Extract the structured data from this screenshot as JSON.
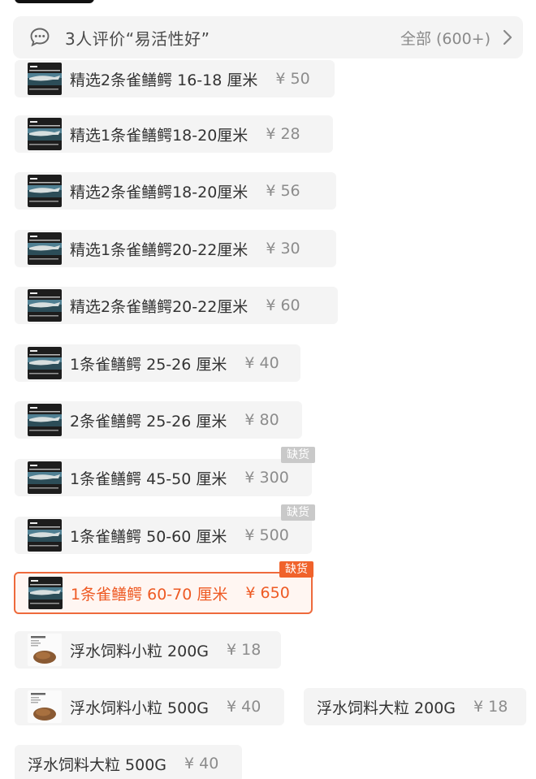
{
  "reviews": {
    "summary": "3人评价“易活性好”",
    "all_label": "全部 (600+)"
  },
  "options": [
    {
      "name": "精选2条雀鳝鳄 16-18 厘米",
      "price": "¥ 50",
      "thumb": "fish"
    },
    {
      "name": "精选1条雀鳝鳄18-20厘米",
      "price": "¥ 28",
      "thumb": "fish"
    },
    {
      "name": "精选2条雀鳝鳄18-20厘米",
      "price": "¥ 56",
      "thumb": "fish"
    },
    {
      "name": "精选1条雀鳝鳄20-22厘米",
      "price": "¥ 30",
      "thumb": "fish"
    },
    {
      "name": "精选2条雀鳝鳄20-22厘米",
      "price": "¥ 60",
      "thumb": "fish"
    },
    {
      "name": "1条雀鳝鳄 25-26 厘米",
      "price": "¥ 40",
      "thumb": "fish"
    },
    {
      "name": "2条雀鳝鳄 25-26 厘米",
      "price": "¥ 80",
      "thumb": "fish"
    },
    {
      "name": "1条雀鳝鳄 45-50 厘米",
      "price": "¥ 300",
      "thumb": "fish",
      "tag": "缺货"
    },
    {
      "name": "1条雀鳝鳄 50-60 厘米",
      "price": "¥ 500",
      "thumb": "fish",
      "tag": "缺货"
    },
    {
      "name": "1条雀鳝鳄 60-70 厘米",
      "price": "¥ 650",
      "thumb": "fish",
      "tag": "缺货",
      "selected": true
    },
    {
      "name": "浮水饲料小粒 200G",
      "price": "¥ 18",
      "thumb": "feed"
    },
    {
      "name": "浮水饲料小粒 500G",
      "price": "¥ 40",
      "thumb": "feed"
    },
    {
      "name": "浮水饲料大粒 200G",
      "price": "¥ 18",
      "thumb": "none"
    },
    {
      "name": "浮水饲料大粒 500G",
      "price": "¥ 40",
      "thumb": "none"
    }
  ],
  "colors": {
    "accent": "#ee5a24",
    "tag_out_of_stock": "#c9c9c9",
    "tag_selected": "#f0622b"
  }
}
